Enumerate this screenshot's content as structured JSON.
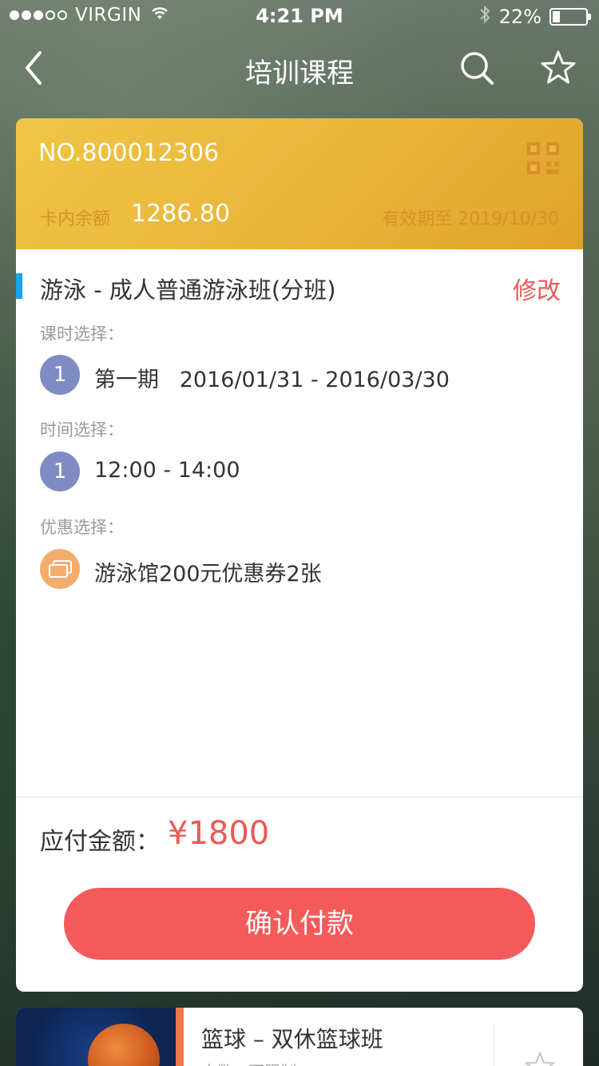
{
  "status_bar": {
    "carrier": "VIRGIN",
    "time": "4:21 PM",
    "battery": "22%",
    "battery_level": 0.22
  },
  "nav": {
    "title": "培训课程",
    "icons": [
      "back-arrow-icon",
      "search-icon",
      "star-icon"
    ]
  },
  "card": {
    "number": "NO.800012306",
    "balance_label": "卡内余额",
    "balance_value": "1286.80",
    "expiry": "有效期至 2019/10/30",
    "accent_color": "#e9b63a"
  },
  "course": {
    "title": "游泳 - 成人普通游泳班(分班)",
    "edit_label": "修改",
    "lesson_label": "课时选择：",
    "lesson_number": "1",
    "lesson_text": "第一期   2016/01/31 - 2016/03/30",
    "time_label": "时间选择：",
    "time_number": "1",
    "time_text": "12:00 - 14:00",
    "discount_label": "优惠选择：",
    "discount_text": "游泳馆200元优惠券2张"
  },
  "payment": {
    "label": "应付金额：",
    "amount": "¥1800",
    "confirm_label": "确认付款",
    "accent_color": "#f35a59"
  },
  "next_course": {
    "title": "篮球 – 双休篮球班",
    "subtitle": "人数 · 不限制"
  }
}
